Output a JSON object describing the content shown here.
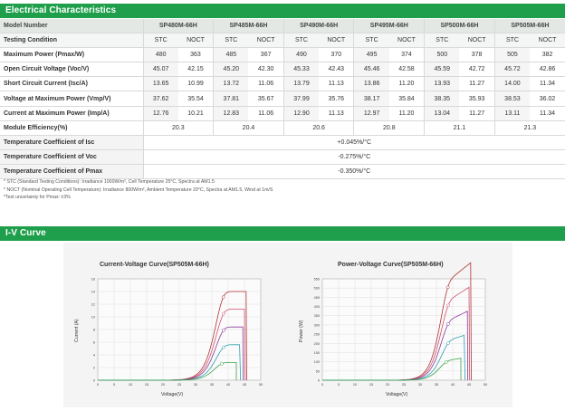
{
  "section1_title": "Electrical Characteristics",
  "section2_title": "I-V Curve",
  "table": {
    "header_label": "Model Number",
    "models": [
      "SP480M-66H",
      "SP485M-66H",
      "SP490M-66H",
      "SP495M-66H",
      "SP500M-66H",
      "SP505M-66H"
    ],
    "condition_label": "Testing Condition",
    "conditions": [
      "STC",
      "NOCT"
    ],
    "rows": [
      {
        "label": "Maximum Power (Pmax/W)",
        "values": [
          "480",
          "363",
          "485",
          "367",
          "490",
          "370",
          "495",
          "374",
          "500",
          "378",
          "505",
          "382"
        ]
      },
      {
        "label": "Open Circuit Voltage (Voc/V)",
        "values": [
          "45.07",
          "42.15",
          "45.20",
          "42.30",
          "45.33",
          "42.43",
          "45.46",
          "42.58",
          "45.59",
          "42.72",
          "45.72",
          "42.86"
        ]
      },
      {
        "label": "Short Circuit Current (Isc/A)",
        "values": [
          "13.65",
          "10.99",
          "13.72",
          "11.06",
          "13.79",
          "11.13",
          "13.86",
          "11.20",
          "13.93",
          "11.27",
          "14.00",
          "11.34"
        ]
      },
      {
        "label": "Voltage at Maximum Power (Vmp/V)",
        "values": [
          "37.62",
          "35.54",
          "37.81",
          "35.67",
          "37.99",
          "35.76",
          "38.17",
          "35.84",
          "38.35",
          "35.93",
          "38.53",
          "36.02"
        ]
      },
      {
        "label": "Current at Maximum Power (Imp/A)",
        "values": [
          "12.76",
          "10.21",
          "12.83",
          "11.06",
          "12.90",
          "11.13",
          "12.97",
          "11.20",
          "13.04",
          "11.27",
          "13.11",
          "11.34"
        ]
      }
    ],
    "efficiency": {
      "label": "Module Efficiency(%)",
      "values": [
        "20.3",
        "20.4",
        "20.6",
        "20.8",
        "21.1",
        "21.3"
      ]
    },
    "coefficients": [
      {
        "label": "Temperature Coefficient of Isc",
        "value": "+0.045%/°C"
      },
      {
        "label": "Temperature Coefficient of Voc",
        "value": "-0.275%/°C"
      },
      {
        "label": "Temperature Coefficient of Pmax",
        "value": "-0.350%/°C"
      }
    ]
  },
  "notes": [
    "* STC (Standard Testing Conditions): Irradiance 1000W/m², Cell Temperature 25°C, Spectra at AM1.5",
    "* NOCT (Nominal Operating Cell Temperature): Irradiance 800W/m², Ambient Temperature 20°C, Spectra at AM1.5, Wind at 1m/S",
    "*Test uncertainty for Pmax: ±3%"
  ],
  "colors": {
    "accent": "#1f9f4b"
  },
  "chart_data": [
    {
      "type": "line",
      "title": "Current-Voltage Curve(SP505M-66H)",
      "xlabel": "Voltage(V)",
      "ylabel": "Current (A)",
      "xlim": [
        0,
        50
      ],
      "ylim": [
        0,
        16
      ],
      "x_ticks": [
        0,
        5,
        10,
        15,
        20,
        25,
        30,
        35,
        40,
        45,
        50
      ],
      "y_ticks": [
        0,
        2,
        4,
        6,
        8,
        10,
        12,
        14,
        16
      ],
      "series": [
        {
          "irradiance": 1000,
          "isc": 14.0,
          "voc": 45.7,
          "vmp": 38.5,
          "imp": 13.1,
          "color": "#b03030"
        },
        {
          "irradiance": 800,
          "isc": 11.2,
          "voc": 45.2,
          "vmp": 38.6,
          "imp": 10.5,
          "color": "#d05070"
        },
        {
          "irradiance": 600,
          "isc": 8.4,
          "voc": 44.6,
          "vmp": 38.6,
          "imp": 7.9,
          "color": "#8a3a9a"
        },
        {
          "irradiance": 400,
          "isc": 5.6,
          "voc": 43.8,
          "vmp": 38.6,
          "imp": 5.2,
          "color": "#2f9fb0"
        },
        {
          "irradiance": 200,
          "isc": 2.8,
          "voc": 42.5,
          "vmp": 38.0,
          "imp": 2.6,
          "color": "#3aa34a"
        }
      ]
    },
    {
      "type": "line",
      "title": "Power-Voltage Curve(SP505M-66H)",
      "xlabel": "Voltage(V)",
      "ylabel": "Power (W)",
      "xlim": [
        0,
        50
      ],
      "ylim": [
        0,
        550
      ],
      "x_ticks": [
        0,
        5,
        10,
        15,
        20,
        25,
        30,
        35,
        40,
        45,
        50
      ],
      "y_ticks": [
        0,
        50,
        100,
        150,
        200,
        250,
        300,
        350,
        400,
        450,
        500,
        550
      ],
      "series": [
        {
          "irradiance": 1000,
          "isc": 14.0,
          "voc": 45.7,
          "vmp": 38.5,
          "imp": 13.1,
          "color": "#b03030"
        },
        {
          "irradiance": 800,
          "isc": 11.2,
          "voc": 45.2,
          "vmp": 38.6,
          "imp": 10.5,
          "color": "#d05070"
        },
        {
          "irradiance": 600,
          "isc": 8.4,
          "voc": 44.6,
          "vmp": 38.6,
          "imp": 7.9,
          "color": "#8a3a9a"
        },
        {
          "irradiance": 400,
          "isc": 5.6,
          "voc": 43.8,
          "vmp": 38.6,
          "imp": 5.2,
          "color": "#2f9fb0"
        },
        {
          "irradiance": 200,
          "isc": 2.8,
          "voc": 42.5,
          "vmp": 38.0,
          "imp": 2.6,
          "color": "#3aa34a"
        }
      ]
    }
  ]
}
